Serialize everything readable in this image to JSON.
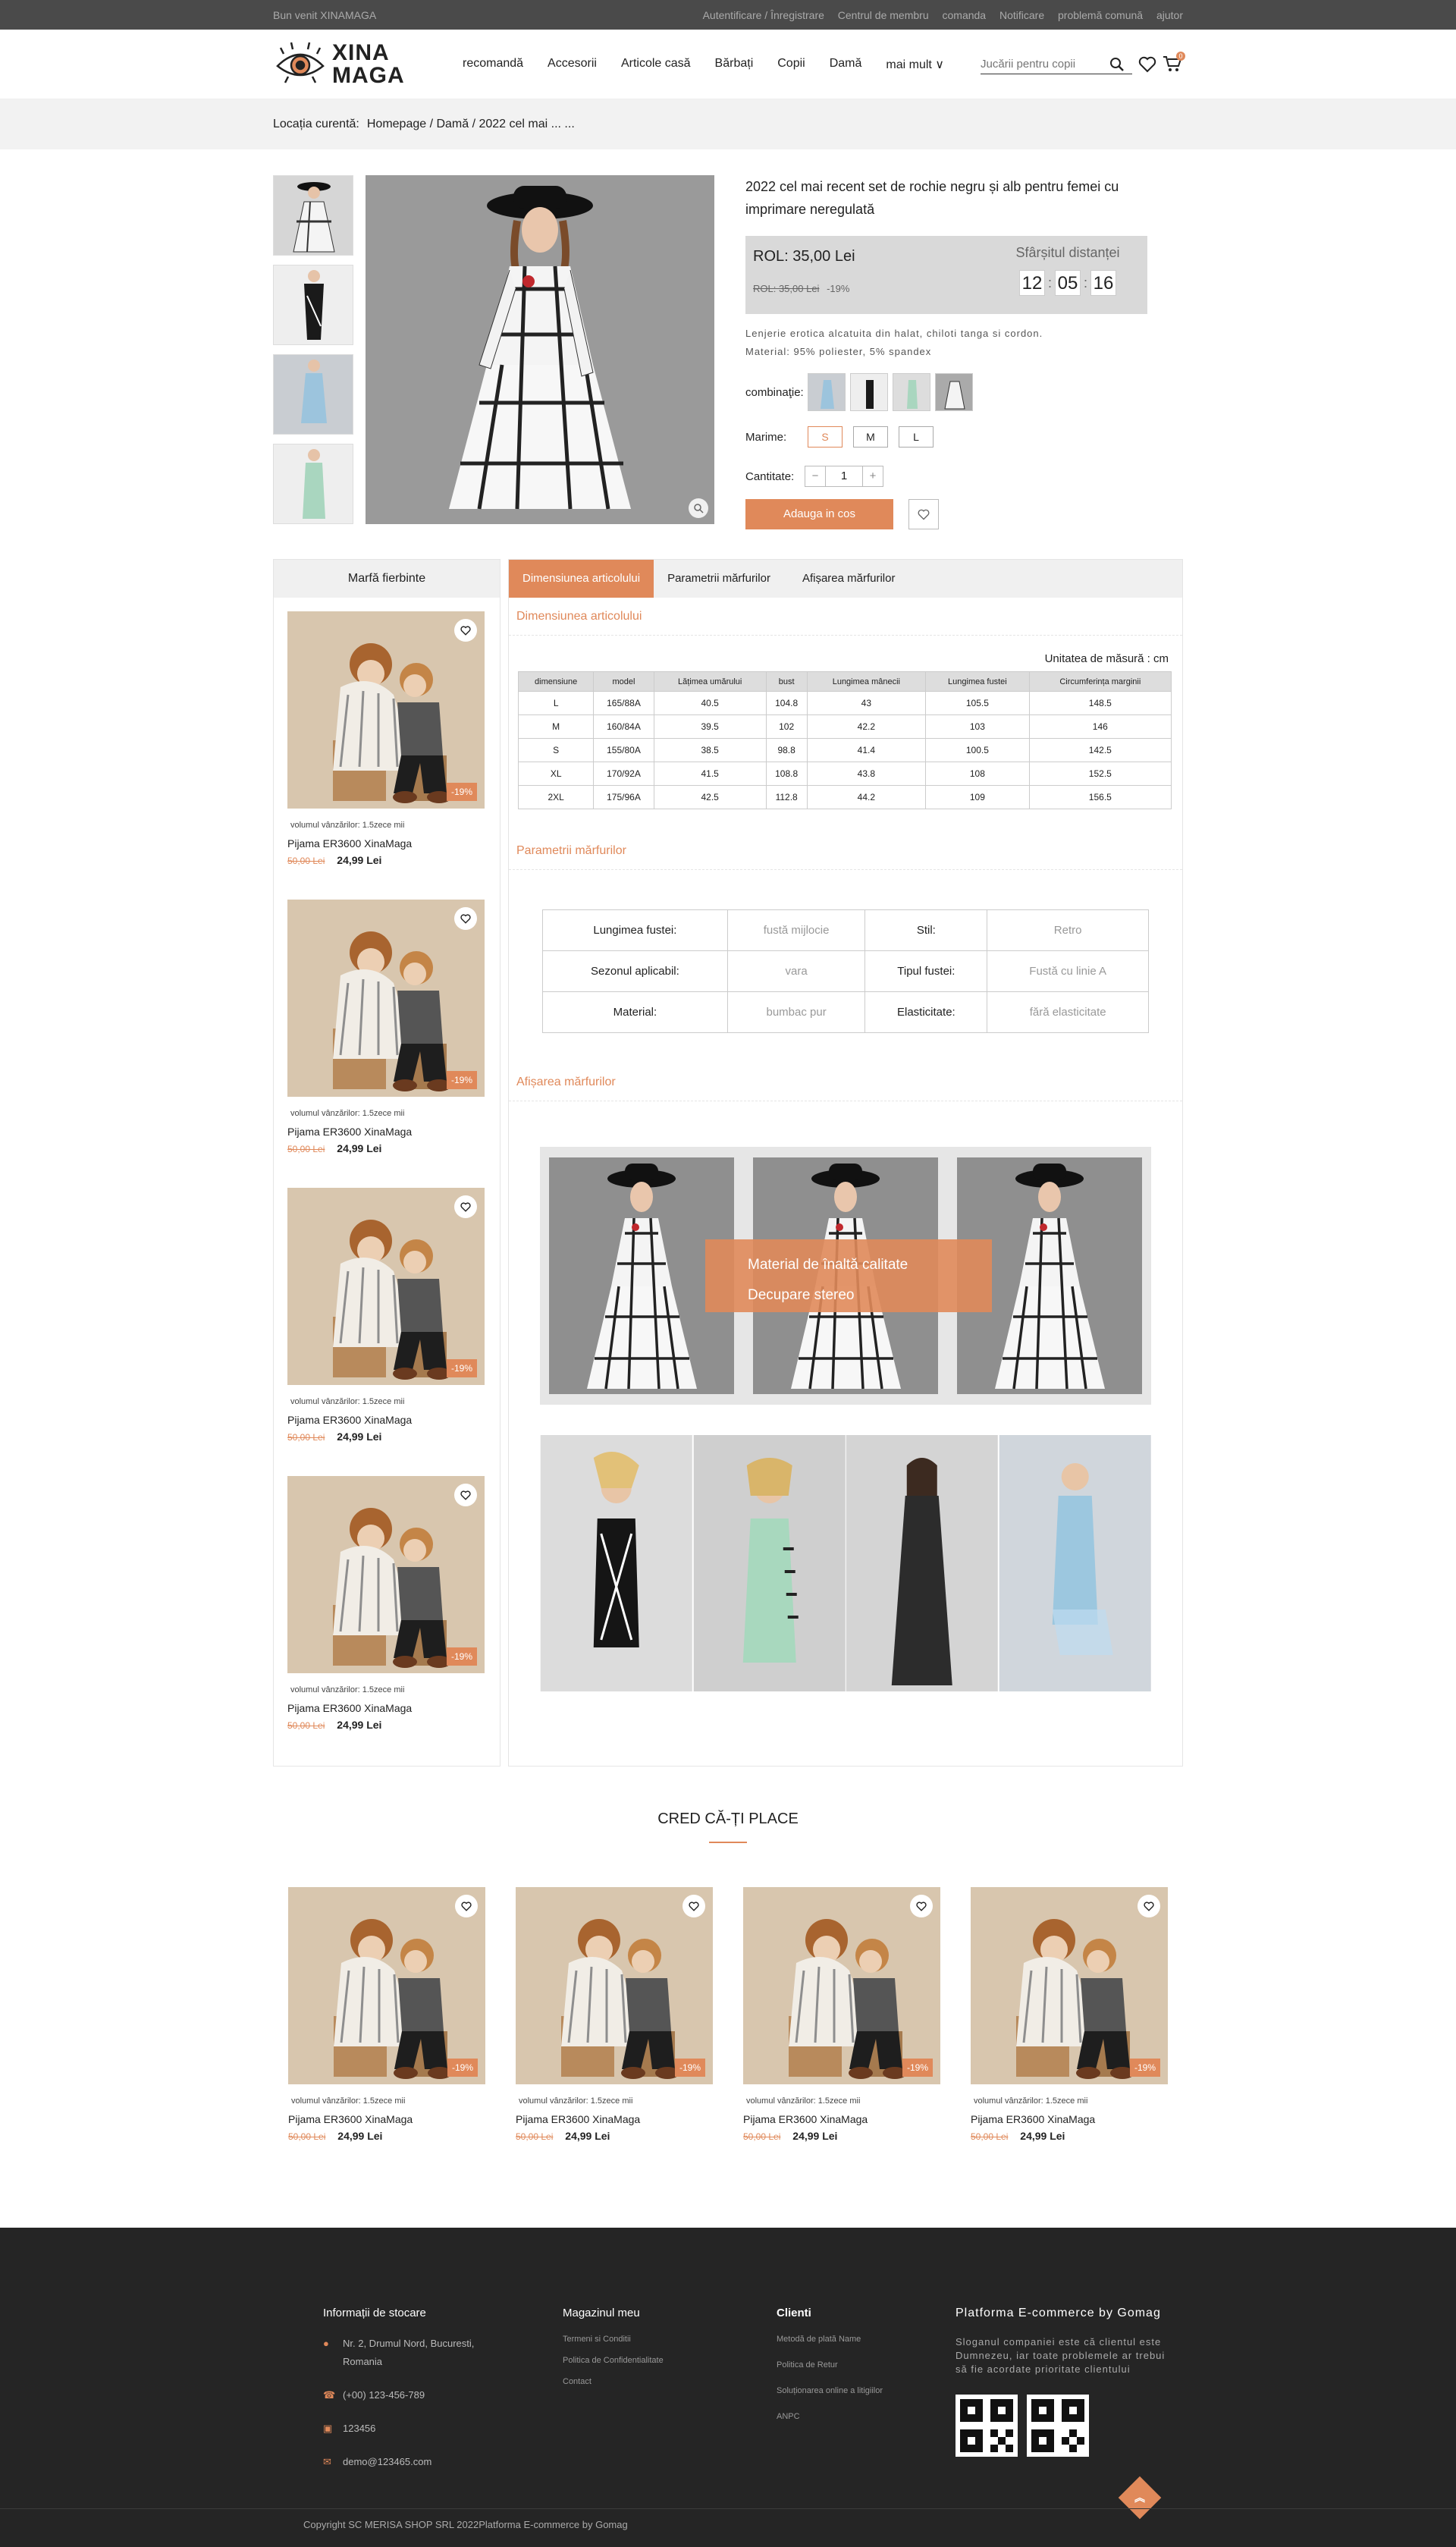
{
  "topbar": {
    "welcome": "Bun venit XINAMAGA",
    "links": [
      "Autentificare / Înregistrare",
      "Centrul de membru",
      "comanda",
      "Notificare",
      "problemă comună",
      "ajutor"
    ]
  },
  "header": {
    "logo_line1": "XINA",
    "logo_line2": "MAGA",
    "nav": [
      "recomandă",
      "Accesorii",
      "Articole casă",
      "Bărbați",
      "Copii",
      "Damă",
      "mai mult ∨"
    ],
    "search_placeholder": "Jucării pentru copii",
    "cart_count": "0"
  },
  "breadcrumb": {
    "label": "Locația curentă:",
    "path": "Homepage / Damă / 2022 cel mai ...  ..."
  },
  "product": {
    "title": "2022 cel mai recent set de rochie negru și alb pentru femei cu imprimare neregulată",
    "price": "ROL:  35,00 Lei",
    "old_price": "ROL:  35,00 Lei",
    "discount": "-19%",
    "countdown_label": "Sfârșitul distanței",
    "countdown": [
      "12",
      "05",
      "16"
    ],
    "description": "Lenjerie erotica alcatuita din halat, chiloti tanga si cordon.",
    "material": "Material:  95% poliester, 5% spandex",
    "combination_label": "combinaţie:",
    "size_label": "Marime:",
    "sizes": [
      "S",
      "M",
      "L"
    ],
    "selected_size": "S",
    "qty_label": "Cantitate:",
    "qty_minus": "−",
    "qty": "1",
    "qty_plus": "+",
    "add_to_cart": "Adauga in cos"
  },
  "sidebar": {
    "title": "Marfă fierbinte",
    "items": [
      {
        "volume": "volumul vânzărilor:  1.5zece mii",
        "name": "Pijama ER3600 XinaMaga",
        "old_price": "50,00 Lei",
        "price": "24,99 Lei",
        "discount": "-19%"
      },
      {
        "volume": "volumul vânzărilor:  1.5zece mii",
        "name": "Pijama ER3600 XinaMaga",
        "old_price": "50,00 Lei",
        "price": "24,99 Lei",
        "discount": "-19%"
      },
      {
        "volume": "volumul vânzărilor:  1.5zece mii",
        "name": "Pijama ER3600 XinaMaga",
        "old_price": "50,00 Lei",
        "price": "24,99 Lei",
        "discount": "-19%"
      },
      {
        "volume": "volumul vânzărilor:  1.5zece mii",
        "name": "Pijama ER3600 XinaMaga",
        "old_price": "50,00 Lei",
        "price": "24,99 Lei",
        "discount": "-19%"
      }
    ]
  },
  "tabs": [
    "Dimensiunea articolului",
    "Parametrii mărfurilor",
    "Afișarea mărfurilor"
  ],
  "size_section": {
    "heading": "Dimensiunea articolului",
    "unit": "Unitatea de măsură : cm",
    "columns": [
      "dimensiune",
      "model",
      "Lățimea umărului",
      "bust",
      "Lungimea mânecii",
      "Lungimea fustei",
      "Circumferința marginii"
    ],
    "rows": [
      [
        "L",
        "165/88A",
        "40.5",
        "104.8",
        "43",
        "105.5",
        "148.5"
      ],
      [
        "M",
        "160/84A",
        "39.5",
        "102",
        "42.2",
        "103",
        "146"
      ],
      [
        "S",
        "155/80A",
        "38.5",
        "98.8",
        "41.4",
        "100.5",
        "142.5"
      ],
      [
        "XL",
        "170/92A",
        "41.5",
        "108.8",
        "43.8",
        "108",
        "152.5"
      ],
      [
        "2XL",
        "175/96A",
        "42.5",
        "112.8",
        "44.2",
        "109",
        "156.5"
      ]
    ]
  },
  "params_section": {
    "heading": "Parametrii mărfurilor",
    "rows": [
      [
        "Lungimea fustei:",
        "fustă mijlocie",
        "Stil:",
        "Retro"
      ],
      [
        "Sezonul aplicabil:",
        "vara",
        "Tipul fustei:",
        "Fustă cu linie A"
      ],
      [
        "Material:",
        "bumbac pur",
        "Elasticitate:",
        "fără elasticitate"
      ]
    ]
  },
  "display_section": {
    "heading": "Afișarea mărfurilor",
    "overlay_line1": "Material de înaltă calitate",
    "overlay_line2": "Decupare stereo"
  },
  "likes": {
    "title": "CRED CĂ-ȚI PLACE",
    "items": [
      {
        "volume": "volumul vânzărilor:  1.5zece mii",
        "name": "Pijama ER3600 XinaMaga",
        "old_price": "50,00 Lei",
        "price": "24,99 Lei",
        "discount": "-19%"
      },
      {
        "volume": "volumul vânzărilor:  1.5zece mii",
        "name": "Pijama ER3600 XinaMaga",
        "old_price": "50,00 Lei",
        "price": "24,99 Lei",
        "discount": "-19%"
      },
      {
        "volume": "volumul vânzărilor:  1.5zece mii",
        "name": "Pijama ER3600 XinaMaga",
        "old_price": "50,00 Lei",
        "price": "24,99 Lei",
        "discount": "-19%"
      },
      {
        "volume": "volumul vânzărilor:  1.5zece mii",
        "name": "Pijama ER3600 XinaMaga",
        "old_price": "50,00 Lei",
        "price": "24,99 Lei",
        "discount": "-19%"
      }
    ]
  },
  "footer": {
    "store_title": "Informații de stocare",
    "address": "Nr. 2, Drumul Nord, Bucuresti, Romania",
    "phone": "(+00) 123-456-789",
    "fax": "123456",
    "email": "demo@123465.com",
    "shop_title": "Magazinul meu",
    "shop_links": [
      "Termeni si Conditii",
      "Politica de Confidentialitate",
      "Contact"
    ],
    "clients_title": "Clienti",
    "clients_links": [
      "Metodă de plată Name",
      "Politica de Retur",
      "Soluționarea online a litigiilor",
      "ANPC"
    ],
    "platform_title": "Platforma E-commerce by Gomag",
    "slogan": "Sloganul companiei este că clientul este Dumnezeu, iar toate problemele ar trebui să fie acordate prioritate clientului",
    "copyright": "Copyright SC MERISA SHOP SRL 2022Platforma E-commerce by Gomag"
  },
  "colors": {
    "accent": "#e0895a",
    "topbar": "#4a4a4a",
    "footer": "#252525"
  }
}
